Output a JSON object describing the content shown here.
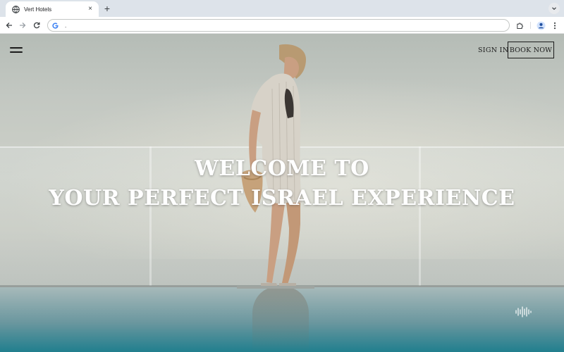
{
  "browser": {
    "tab_title": "Vert Hotels",
    "tab_close": "×",
    "new_tab": "+",
    "address": "."
  },
  "site": {
    "sign_in_label": "SIGN IN",
    "book_now_label": "BOOK NOW",
    "hero_line1": "WELCOME TO",
    "hero_line2": "YOUR PERFECT ISRAEL EXPERIENCE"
  },
  "icons": {
    "tab_favicon": "globe-icon",
    "back": "back-arrow-icon",
    "forward": "forward-arrow-icon",
    "reload": "reload-icon",
    "omnibox": "google-g-icon",
    "extensions": "puzzle-icon",
    "profile": "profile-icon",
    "more": "kebab-menu-icon",
    "menu": "hamburger-menu-icon",
    "sound": "sound-wave-icon"
  },
  "colors": {
    "tabstrip": "#dde3ea",
    "text_dark": "#1b1b1b",
    "hero_text": "#ffffff",
    "water": "#217f8e"
  }
}
